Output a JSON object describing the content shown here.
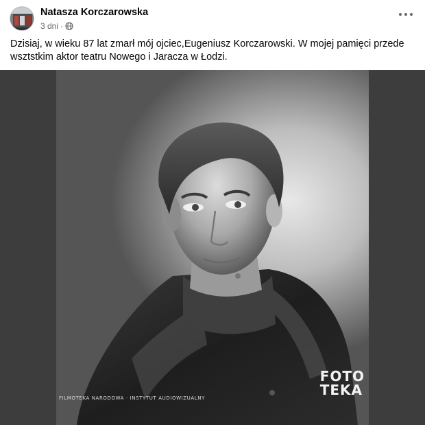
{
  "post": {
    "author": "Natasza Korczarowska",
    "time": "3 dni",
    "separator": "·",
    "privacy_icon": "globe-icon",
    "more_icon": "more-horizontal-icon",
    "text_line1": "Dzisiaj, w wieku 87 lat zmarł mój ojciec,Eugeniusz Korczarowski. W mojej pamięci przede",
    "text_line2": "wsztstkim aktor teatru Nowego i Jaracza w Łodzi."
  },
  "photo": {
    "watermark_line1": "FOTO",
    "watermark_line2": "TEKA",
    "credit": "FILMOTEKA NARODOWA · INSTYTUT AUDIOWIZUALNY"
  },
  "colors": {
    "text_primary": "#050505",
    "text_secondary": "#65676b",
    "photo_side_band": "#3d3d3d"
  }
}
